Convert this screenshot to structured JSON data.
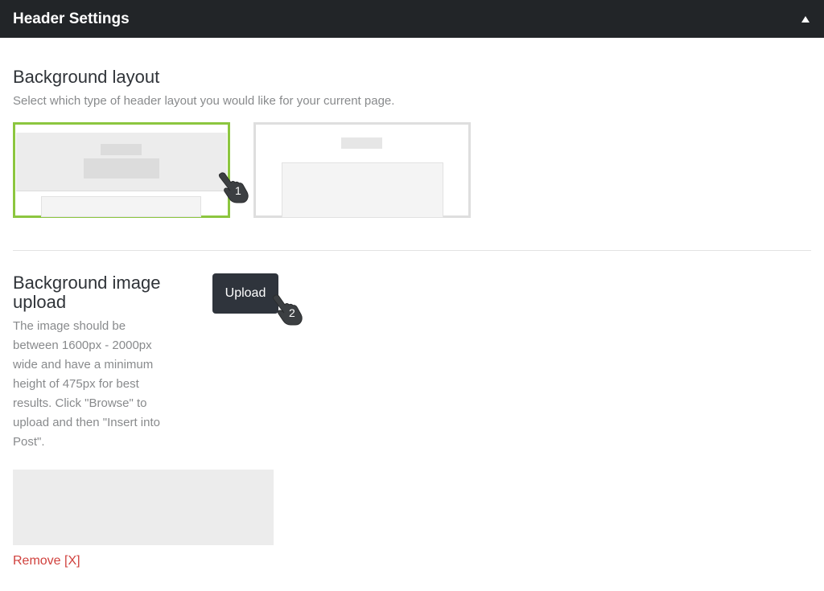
{
  "header": {
    "title": "Header Settings",
    "toggle_icon": "collapse-triangle-icon"
  },
  "layout_section": {
    "heading": "Background layout",
    "description": "Select which type of header layout you would like for your current page.",
    "options": [
      {
        "name": "full-width-header-layout",
        "selected": true
      },
      {
        "name": "boxed-header-layout",
        "selected": false
      }
    ]
  },
  "upload_section": {
    "heading_line1": "Background image",
    "heading_line2": "upload",
    "description_lines": [
      "The image should be",
      "between 1600px - 2000px",
      "wide and have a minimum",
      "height of 475px for best",
      "results. Click \"Browse\" to",
      "upload and then \"Insert into",
      "Post\"."
    ],
    "upload_label": "Upload",
    "remove_label": "Remove [X]"
  },
  "annotations": {
    "step1": "1",
    "step2": "2",
    "icon": "pointing-hand-icon"
  },
  "colors": {
    "topbar": "#222528",
    "selected_border": "#8cc63f",
    "unselected_border": "#dedede",
    "button": "#2f343c",
    "remove_link": "#d0413d"
  }
}
